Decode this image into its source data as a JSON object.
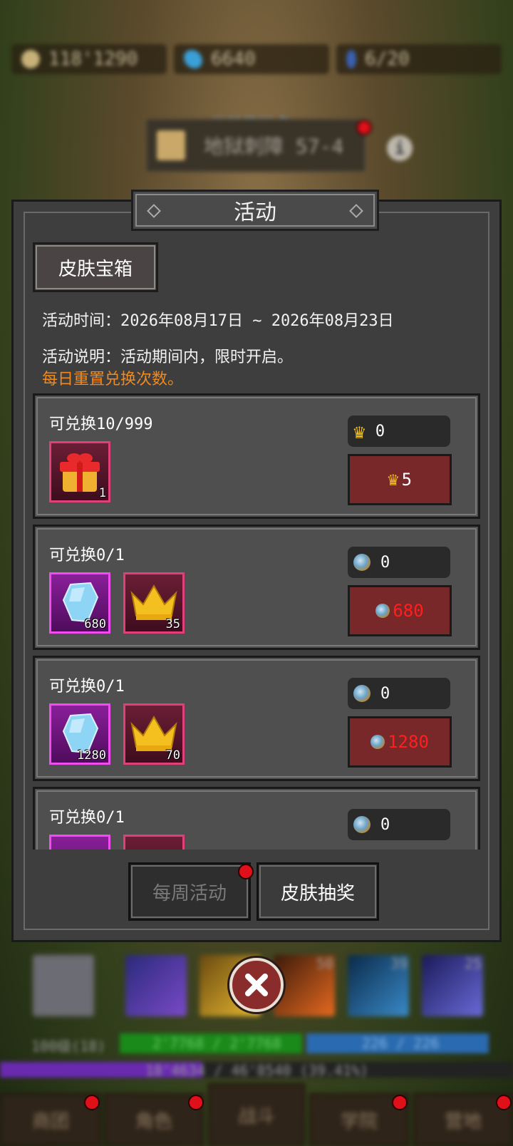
{
  "resources": [
    {
      "icon": "gold-coin-icon",
      "value": "118'1290"
    },
    {
      "icon": "blue-gem-icon",
      "value": "6640"
    },
    {
      "icon": "stamina-icon",
      "value": "6/20"
    }
  ],
  "location": {
    "label": "当前传送点",
    "name": "地狱刺障 57-4"
  },
  "panel": {
    "title": "活动",
    "section_tab": "皮肤宝箱",
    "time_line": "活动时间：2026年08月17日 ~ 2026年08月23日",
    "desc_line": "活动说明：活动期间内，限时开启。",
    "reset_note": "每日重置兑换次数。"
  },
  "cards": [
    {
      "count": "可兑换10/999",
      "items": [
        {
          "icon": "gift-box-icon",
          "qty": "1"
        }
      ],
      "currency_icon": "crown-icon",
      "owned": "0",
      "price": "5",
      "insufficient": false
    },
    {
      "count": "可兑换0/1",
      "items": [
        {
          "icon": "crystal-icon",
          "qty": "680"
        },
        {
          "icon": "crown-icon",
          "qty": "35"
        }
      ],
      "currency_icon": "orb-coin-icon",
      "owned": "0",
      "price": "680",
      "insufficient": true
    },
    {
      "count": "可兑换0/1",
      "items": [
        {
          "icon": "crystal-icon",
          "qty": "1280"
        },
        {
          "icon": "crown-icon",
          "qty": "70"
        }
      ],
      "currency_icon": "orb-coin-icon",
      "owned": "0",
      "price": "1280",
      "insufficient": true
    },
    {
      "count": "可兑换0/1",
      "items": [],
      "currency_icon": "orb-coin-icon",
      "owned": "0",
      "price": "",
      "insufficient": true
    }
  ],
  "bottom_tabs": [
    {
      "label": "每周活动",
      "active": false,
      "badge": true
    },
    {
      "label": "皮肤抽奖",
      "active": true,
      "badge": false
    }
  ],
  "hud": {
    "level": "100级(18)",
    "hp": "2'7768 / 2'7768",
    "mp": "226 / 226",
    "xp": "18'4634 / 46'8540 (39.41%)",
    "skill_levels": [
      "",
      "",
      "50",
      "39",
      "25"
    ]
  },
  "nav": [
    {
      "label": "商团",
      "badge": true
    },
    {
      "label": "角色",
      "badge": true
    },
    {
      "label": "战斗",
      "badge": false
    },
    {
      "label": "学院",
      "badge": true
    },
    {
      "label": "营地",
      "badge": true
    }
  ],
  "colors": {
    "buy_button": "#782828",
    "insufficient_price": "#ff1f1f",
    "reset_note": "#f08a1e"
  }
}
